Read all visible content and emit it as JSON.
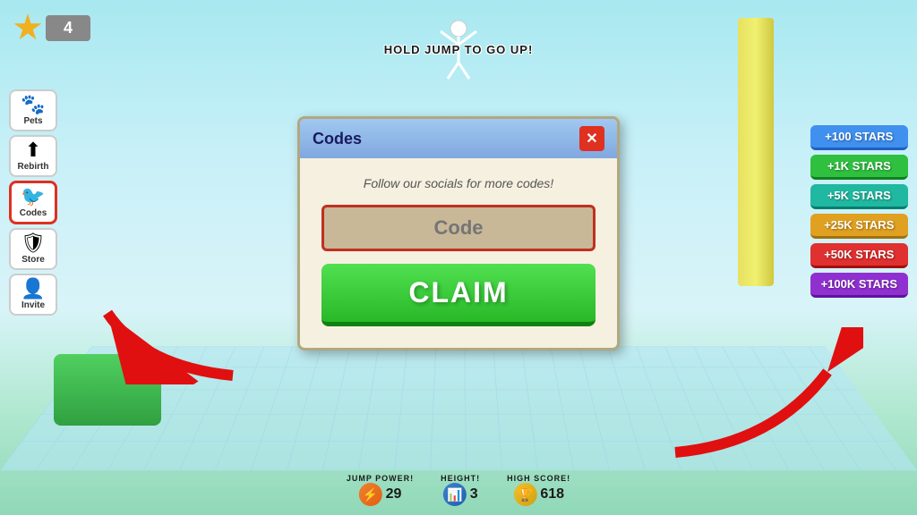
{
  "game": {
    "hold_jump_text": "HOLD JUMP TO GO UP!",
    "star_count": "4"
  },
  "sidebar": {
    "items": [
      {
        "label": "Pets",
        "icon": "🐾"
      },
      {
        "label": "Rebirth",
        "icon": "⬆"
      },
      {
        "label": "Codes",
        "icon": "🐦",
        "active": true
      },
      {
        "label": "Store",
        "icon": "🛡"
      },
      {
        "label": "Invite",
        "icon": "👤"
      }
    ]
  },
  "bonus_buttons": [
    {
      "label": "+100 STARS",
      "color": "blue"
    },
    {
      "label": "+1K STARS",
      "color": "green"
    },
    {
      "label": "+5K STARS",
      "color": "teal"
    },
    {
      "label": "+25K STARS",
      "color": "yellow"
    },
    {
      "label": "+50K STARS",
      "color": "red"
    },
    {
      "label": "+100K STARS",
      "color": "purple"
    }
  ],
  "modal": {
    "title": "Codes",
    "close_label": "✕",
    "subtitle": "Follow our socials for more codes!",
    "code_placeholder": "Code",
    "claim_label": "CLAIM"
  },
  "hud": {
    "jump_power_label": "JUMP POWER!",
    "jump_power_val": "29",
    "height_label": "HEIGHT!",
    "height_val": "3",
    "high_score_label": "HIGH SCORE!",
    "high_score_val": "618"
  }
}
